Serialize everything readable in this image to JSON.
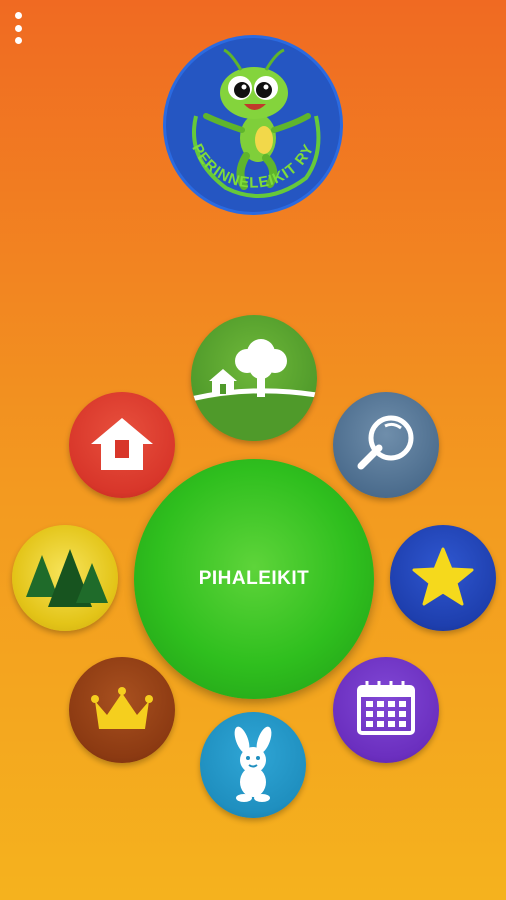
{
  "menu": {
    "icon": "more-vert-icon"
  },
  "logo": {
    "text": "PERINNELEIKIT RY",
    "icon": "grasshopper-jumprope-logo"
  },
  "center_button": {
    "label": "PIHALEIKIT"
  },
  "category_buttons": [
    {
      "name": "yard-games",
      "icon": "house-and-tree-icon",
      "color": "#4f9a2a"
    },
    {
      "name": "search",
      "icon": "magnifier-icon",
      "color": "#4a6b8c"
    },
    {
      "name": "favorites",
      "icon": "star-icon",
      "color": "#1e3fae"
    },
    {
      "name": "calendar",
      "icon": "calendar-icon",
      "color": "#6b2fbf"
    },
    {
      "name": "kids",
      "icon": "bunny-icon",
      "color": "#1f8fbf"
    },
    {
      "name": "royal-games",
      "icon": "crown-icon",
      "color": "#8c3a12"
    },
    {
      "name": "forest-games",
      "icon": "pine-trees-icon",
      "color": "#e3c418"
    },
    {
      "name": "indoor-games",
      "icon": "home-icon",
      "color": "#d8362a"
    }
  ],
  "colors": {
    "background_top": "#f06a22",
    "background_bottom": "#f5b21e",
    "center_green": "#2fbf1e",
    "logo_blue": "#2556c2"
  }
}
